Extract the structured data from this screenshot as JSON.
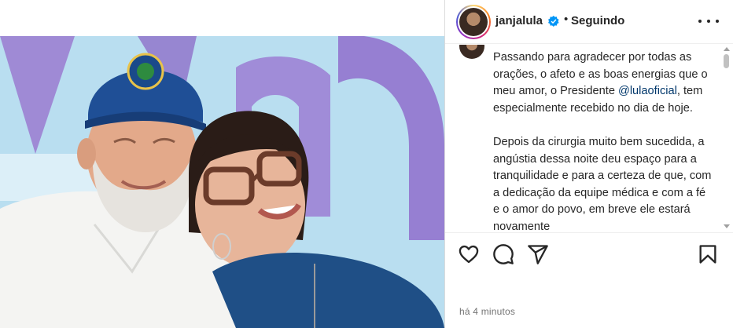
{
  "post": {
    "username": "janjalula",
    "separator": "•",
    "follow_status": "Seguindo",
    "timestamp": "há 4 minutos",
    "caption": {
      "paragraph1_before": "Passando para agradecer por todas as orações, o afeto e as boas energias que o meu amor, o Presidente ",
      "mention": "@lulaoficial",
      "paragraph1_after": ", tem especialmente recebido no dia de hoje.",
      "paragraph2": "Depois da cirurgia muito bem sucedida, a angústia dessa noite deu espaço para a tranquilidade e para a certeza de que, com a dedicação da equipe médica e com a fé e o amor do povo, em breve ele estará novamente"
    }
  },
  "icons": {
    "verified": "verified-badge-icon",
    "more": "more-options-icon",
    "like": "heart-icon",
    "comment": "comment-icon",
    "share": "share-icon",
    "save": "bookmark-icon"
  },
  "colors": {
    "verified_blue": "#0095f6",
    "mention": "#00376b",
    "text": "#262626",
    "muted": "#737373"
  }
}
